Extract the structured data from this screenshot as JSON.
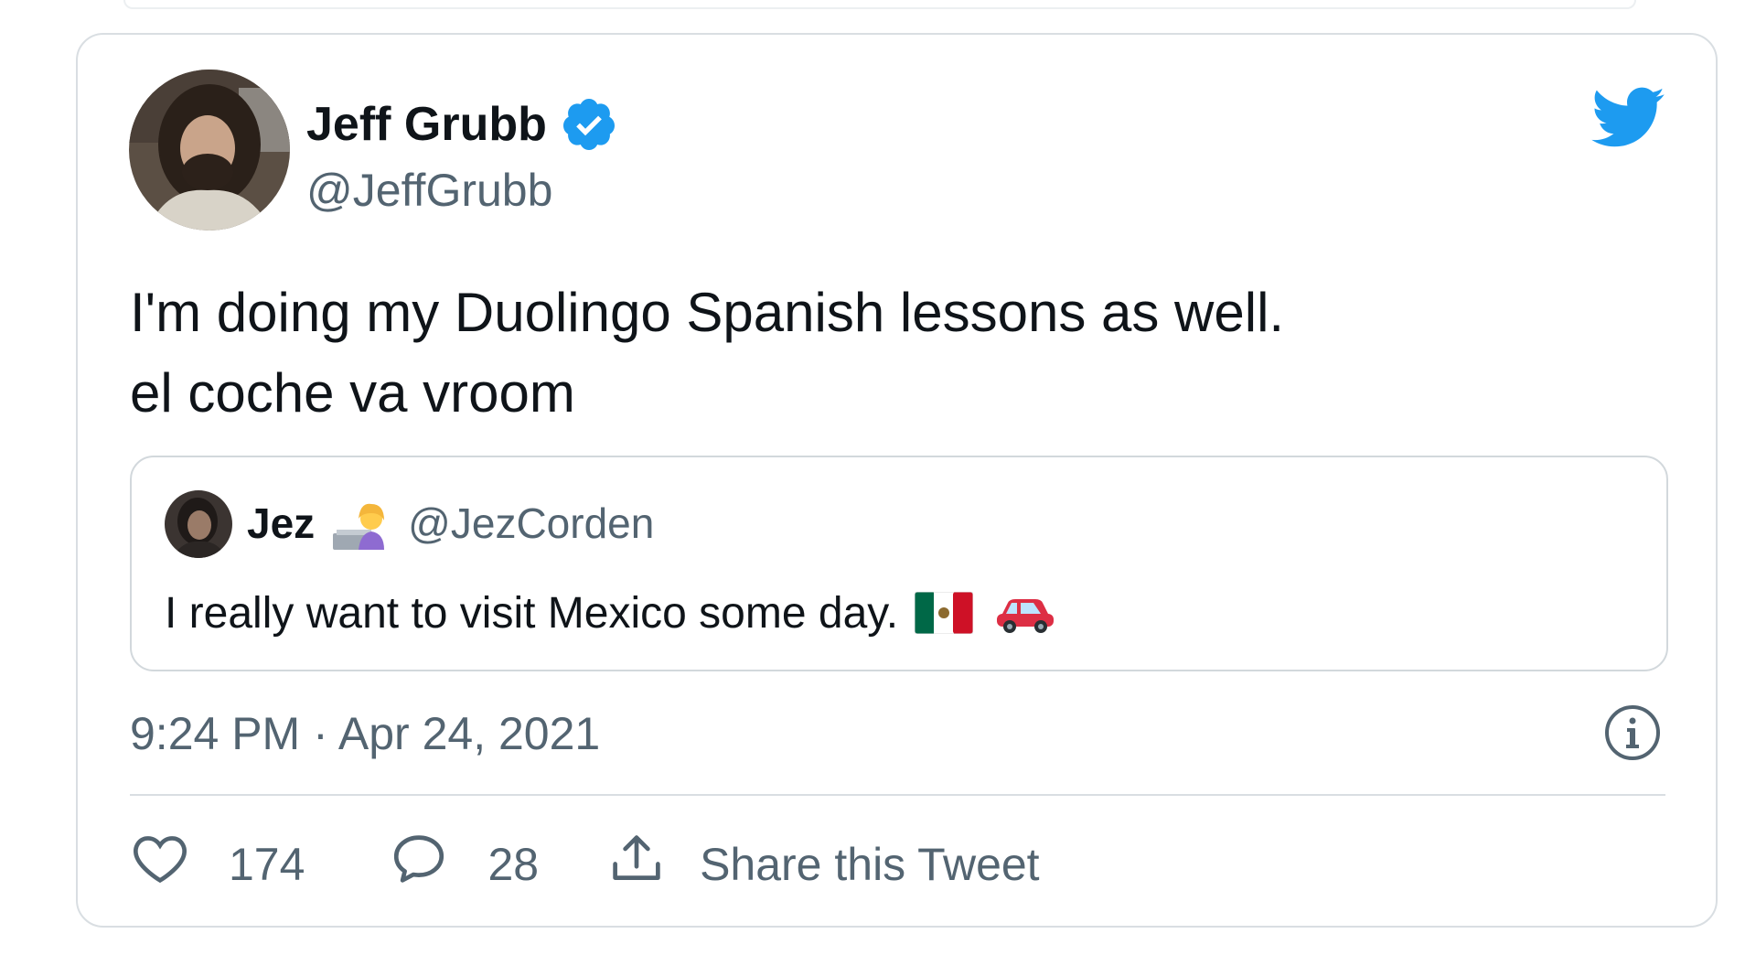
{
  "tweet": {
    "author_name": "Jeff Grubb",
    "author_handle": "@JeffGrubb",
    "text": "I'm doing my Duolingo Spanish lessons as well.\nel coche va vroom",
    "timestamp": "9:24 PM · Apr 24, 2021",
    "verified": true,
    "accent_color": "#1d9bf0"
  },
  "quoted_tweet": {
    "author_name": "Jez",
    "author_handle": "@JezCorden",
    "text": "I really want to visit Mexico some day."
  },
  "actions": {
    "likes_count": "174",
    "replies_count": "28",
    "share_label": "Share this Tweet"
  },
  "icons": {
    "brand": "twitter-bird-icon",
    "verified": "verified-badge-icon",
    "info": "info-icon",
    "like": "heart-icon",
    "reply": "reply-bubble-icon",
    "share": "share-icon"
  }
}
